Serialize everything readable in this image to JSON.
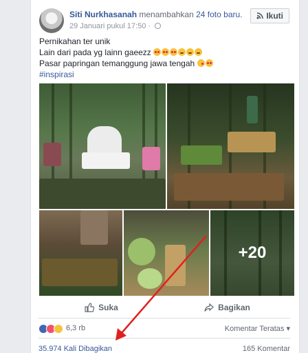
{
  "post": {
    "author": "Siti Nurkhasanah",
    "action_prefix": "menambahkan",
    "action_link": "24 foto baru.",
    "timestamp": "29 Januari pukul 17:50 · ",
    "follow_label": "Ikuti",
    "text_line1": "Pernikahan ter unik",
    "text_line2": "Lain dari pada yg lainn gaeezz",
    "text_line3": "Pasar papringan temanggung jawa tengah",
    "hashtag": "#inspirasi"
  },
  "photos": {
    "more_count": "+20"
  },
  "actions": {
    "like_label": "Suka",
    "share_label": "Bagikan"
  },
  "reactions": {
    "count": "6,3 rb",
    "sort_label": "Komentar Teratas"
  },
  "stats": {
    "shares": "35.974 Kali Dibagikan",
    "comments": "165 Komentar"
  },
  "icons": {
    "follow": "rss-follow-icon",
    "like": "thumbs-up-icon",
    "share": "share-arrow-icon",
    "privacy": "globe-icon"
  },
  "colors": {
    "link": "#365899",
    "annotation_arrow": "#e02020"
  }
}
